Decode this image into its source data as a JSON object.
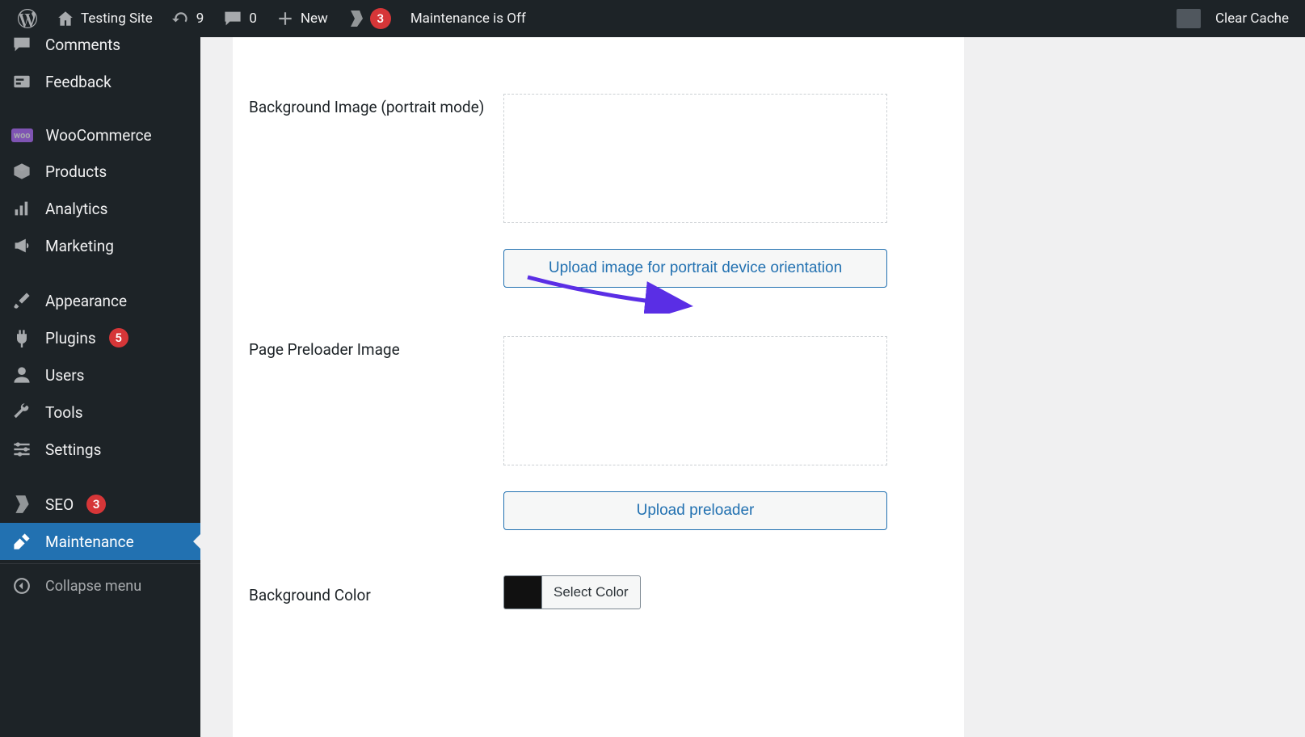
{
  "adminbar": {
    "site_name": "Testing Site",
    "updates_count": "9",
    "comments_count": "0",
    "new_label": "New",
    "yoast_badge": "3",
    "maintenance_label": "Maintenance is Off",
    "clear_cache": "Clear Cache"
  },
  "sidebar": {
    "comments": "Comments",
    "feedback": "Feedback",
    "woocommerce": "WooCommerce",
    "products": "Products",
    "analytics": "Analytics",
    "marketing": "Marketing",
    "appearance": "Appearance",
    "plugins": "Plugins",
    "plugins_badge": "5",
    "users": "Users",
    "tools": "Tools",
    "settings": "Settings",
    "seo": "SEO",
    "seo_badge": "3",
    "maintenance": "Maintenance",
    "collapse": "Collapse menu"
  },
  "fields": {
    "bg_portrait_label": "Background Image (portrait mode)",
    "bg_portrait_button": "Upload image for portrait device orientation",
    "preloader_label": "Page Preloader Image",
    "preloader_button": "Upload preloader",
    "bg_color_label": "Background Color",
    "bg_color_button": "Select Color",
    "bg_color_value": "#111111"
  }
}
